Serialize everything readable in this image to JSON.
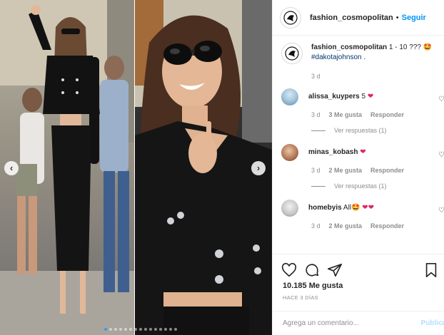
{
  "post": {
    "username": "fashion_cosmopolitan",
    "separator": "•",
    "follow_label": "Seguir"
  },
  "caption": {
    "username": "fashion_cosmopolitan",
    "text": "1 - 10 ??? 🤩",
    "hashtag": "#dakotajohnson",
    "trail": " .",
    "time": "3 d"
  },
  "comments": [
    {
      "username": "alissa_kuypers",
      "text": "5",
      "emoji": "❤",
      "time": "3 d",
      "likes": "3 Me gusta",
      "reply_label": "Responder",
      "view_replies": "Ver respuestas (1)"
    },
    {
      "username": "minas_kobash",
      "text": "",
      "emoji": "❤",
      "time": "3 d",
      "likes": "2 Me gusta",
      "reply_label": "Responder",
      "view_replies": "Ver respuestas (1)"
    },
    {
      "username": "homebyis",
      "text": "All🤩",
      "emoji": "❤❤",
      "time": "3 d",
      "likes": "2 Me gusta",
      "reply_label": "Responder"
    }
  ],
  "stats": {
    "likes": "10.185 Me gusta",
    "date": "HACE 3 DÍAS"
  },
  "composer": {
    "placeholder": "Agrega un comentario...",
    "publish_label": "Publicar"
  },
  "colors": {
    "link_blue": "#0095f6",
    "hashtag_blue": "#00376b",
    "heart_red": "#e0245e",
    "muted_gray": "#8e8e8e"
  },
  "icons": [
    "chevron-left-icon",
    "chevron-right-icon",
    "heart-icon",
    "comment-icon",
    "share-icon",
    "bookmark-icon"
  ]
}
